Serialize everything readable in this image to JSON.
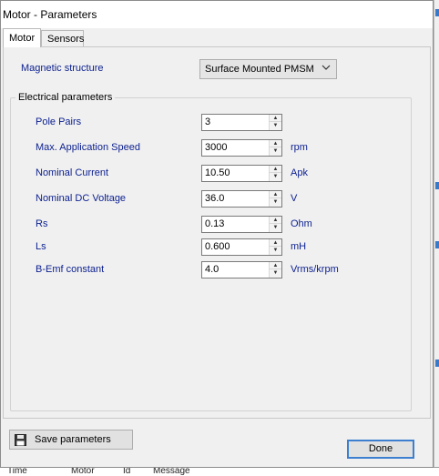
{
  "window": {
    "title": "Motor - Parameters"
  },
  "tabs": [
    {
      "label": "Motor"
    },
    {
      "label": "Sensors"
    }
  ],
  "magnetic": {
    "label": "Magnetic structure",
    "value": "Surface Mounted PMSM"
  },
  "group": {
    "title": "Electrical parameters"
  },
  "params": [
    {
      "label": "Pole Pairs",
      "value": "3",
      "unit": ""
    },
    {
      "label": "Max. Application Speed",
      "value": "3000",
      "unit": "rpm"
    },
    {
      "label": "Nominal Current",
      "value": "10.50",
      "unit": "Apk"
    },
    {
      "label": "Nominal DC Voltage",
      "value": "36.0",
      "unit": "V"
    },
    {
      "label": "Rs",
      "value": "0.13",
      "unit": "Ohm"
    },
    {
      "label": "Ls",
      "value": "0.600",
      "unit": "mH"
    },
    {
      "label": "B-Emf constant",
      "value": "4.0",
      "unit": "Vrms/krpm"
    }
  ],
  "buttons": {
    "save": "Save parameters",
    "done": "Done"
  },
  "background": {
    "col1": "Time",
    "col2": "Motor",
    "col3": "Id",
    "col4": "Message"
  },
  "colors": {
    "label_blue": "#0b1f8f",
    "focus_blue": "#3c7fd0"
  },
  "icons": {
    "save": "floppy-disk-icon",
    "dropdown": "chevron-down-icon",
    "spin_up": "triangle-up-icon",
    "spin_down": "triangle-down-icon"
  }
}
